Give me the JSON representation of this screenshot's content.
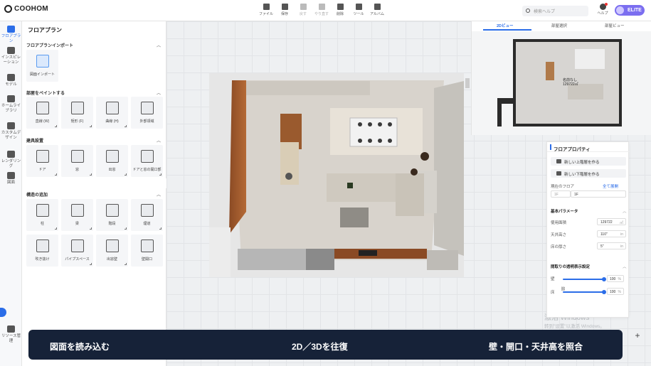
{
  "app": {
    "logo": "COOHOM"
  },
  "toolbar": [
    {
      "label": "ファイル",
      "icon": "file-icon",
      "disabled": false
    },
    {
      "label": "保存",
      "icon": "save-icon",
      "disabled": false
    },
    {
      "label": "戻す",
      "icon": "undo-icon",
      "disabled": true
    },
    {
      "label": "やり直す",
      "icon": "redo-icon",
      "disabled": true
    },
    {
      "label": "削除",
      "icon": "eraser-icon",
      "disabled": false
    },
    {
      "label": "ツール",
      "icon": "tool-icon",
      "disabled": false
    },
    {
      "label": "アルバム",
      "icon": "album-icon",
      "disabled": false
    }
  ],
  "header": {
    "search_placeholder": "検索ヘルプ",
    "help_label": "ヘルプ",
    "badge": "ELITE"
  },
  "rail": [
    {
      "label": "フロアプラン",
      "icon": "floorplan-icon",
      "active": true
    },
    {
      "label": "インスピレーション",
      "icon": "bulb-icon",
      "active": false
    },
    {
      "label": "モデル",
      "icon": "sofa-icon",
      "active": false
    },
    {
      "label": "ホームライブラリ",
      "icon": "home-library-icon",
      "active": false
    },
    {
      "label": "カスタムデザイン",
      "icon": "custom-design-icon",
      "active": false
    },
    {
      "label": "レンダリング",
      "icon": "camera-icon",
      "active": false
    },
    {
      "label": "図面",
      "icon": "drawing-icon",
      "active": false
    },
    {
      "label": "リソース管理",
      "icon": "resource-icon",
      "active": false
    }
  ],
  "panel": {
    "title": "フロアプラン",
    "sections": [
      {
        "title": "フロアプランインポート",
        "items": [
          {
            "label": "図面インポート",
            "icon": "jpg-import-icon"
          }
        ]
      },
      {
        "title": "部屋をペイントする",
        "items": [
          {
            "label": "直線 (W)",
            "icon": "wall-straight-icon"
          },
          {
            "label": "矩形 (F)",
            "icon": "wall-rect-icon"
          },
          {
            "label": "曲線 (H)",
            "icon": "wall-curve-icon"
          },
          {
            "label": "外部領域",
            "icon": "outer-area-icon"
          }
        ]
      },
      {
        "title": "建具設置",
        "items": [
          {
            "label": "ドア",
            "icon": "door-icon"
          },
          {
            "label": "窓",
            "icon": "window-icon"
          },
          {
            "label": "出窓",
            "icon": "bay-window-icon"
          },
          {
            "label": "ドアと窓の開口部",
            "icon": "opening-icon"
          }
        ]
      },
      {
        "title": "構造の追加",
        "items": [
          {
            "label": "柱",
            "icon": "pillar-icon"
          },
          {
            "label": "梁",
            "icon": "beam-icon"
          },
          {
            "label": "階段",
            "icon": "stairs-icon"
          },
          {
            "label": "煙道",
            "icon": "flue-icon"
          },
          {
            "label": "吹き抜け",
            "icon": "void-icon"
          },
          {
            "label": "パイプスペース",
            "icon": "pipe-space-icon"
          },
          {
            "label": "出窓壁",
            "icon": "bay-wall-icon"
          },
          {
            "label": "壁開口",
            "icon": "wall-opening-icon"
          }
        ]
      }
    ]
  },
  "view2d": {
    "tabs": [
      "2Dビュー",
      "部屋選択",
      "部屋ビュー"
    ],
    "active_tab": 0,
    "pin_labels": [
      "名前なし",
      "129722㎡"
    ]
  },
  "props": {
    "title": "フロアプロパティ",
    "add_upper": "新しい上階層を作る",
    "add_lower": "新しい下階層を作る",
    "current_floor_label": "現在のフロア",
    "floor_switch": "全て展開",
    "floor_prefix": "1F",
    "floor_value": "1F",
    "basic_params": "基本パラメータ",
    "area_label": "使用面積",
    "area_value": "129722",
    "area_unit": "㎡",
    "ceiling_label": "天井高さ",
    "ceiling_value": "110\"",
    "ceiling_unit": "in",
    "floor_thickness_label": "床の厚さ",
    "floor_thickness_value": "5\"",
    "floor_thickness_unit": "in",
    "transparency_title": "間取りの透明表示設定",
    "wall_label": "壁",
    "wall_value": 100,
    "floor_label": "床",
    "floor_opacity": 100,
    "percent": "%"
  },
  "watermark": {
    "line1": "激活 Windows",
    "line2": "转到\"设置\"以激活 Windows。"
  },
  "banner": {
    "left": "図面を読み込む",
    "center": "2D／3Dを往復",
    "right": "壁・開口・天井高を照合"
  },
  "colors": {
    "accent": "#2b6de8",
    "banner": "#162238",
    "elite": "#7b6ef0"
  }
}
